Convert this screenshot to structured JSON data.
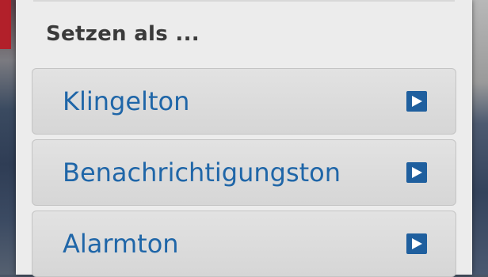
{
  "dialog": {
    "title": "Setzen als ...",
    "options": [
      {
        "label": "Klingelton",
        "icon": "play-icon"
      },
      {
        "label": "Benachrichtigungston",
        "icon": "play-icon"
      },
      {
        "label": "Alarmton",
        "icon": "play-icon"
      }
    ]
  },
  "colors": {
    "option_text": "#1f66a8",
    "icon_fill": "#1f5f9e",
    "title_text": "#3a3a3a",
    "dialog_background": "#ececec",
    "accent_red": "#b2202a"
  }
}
